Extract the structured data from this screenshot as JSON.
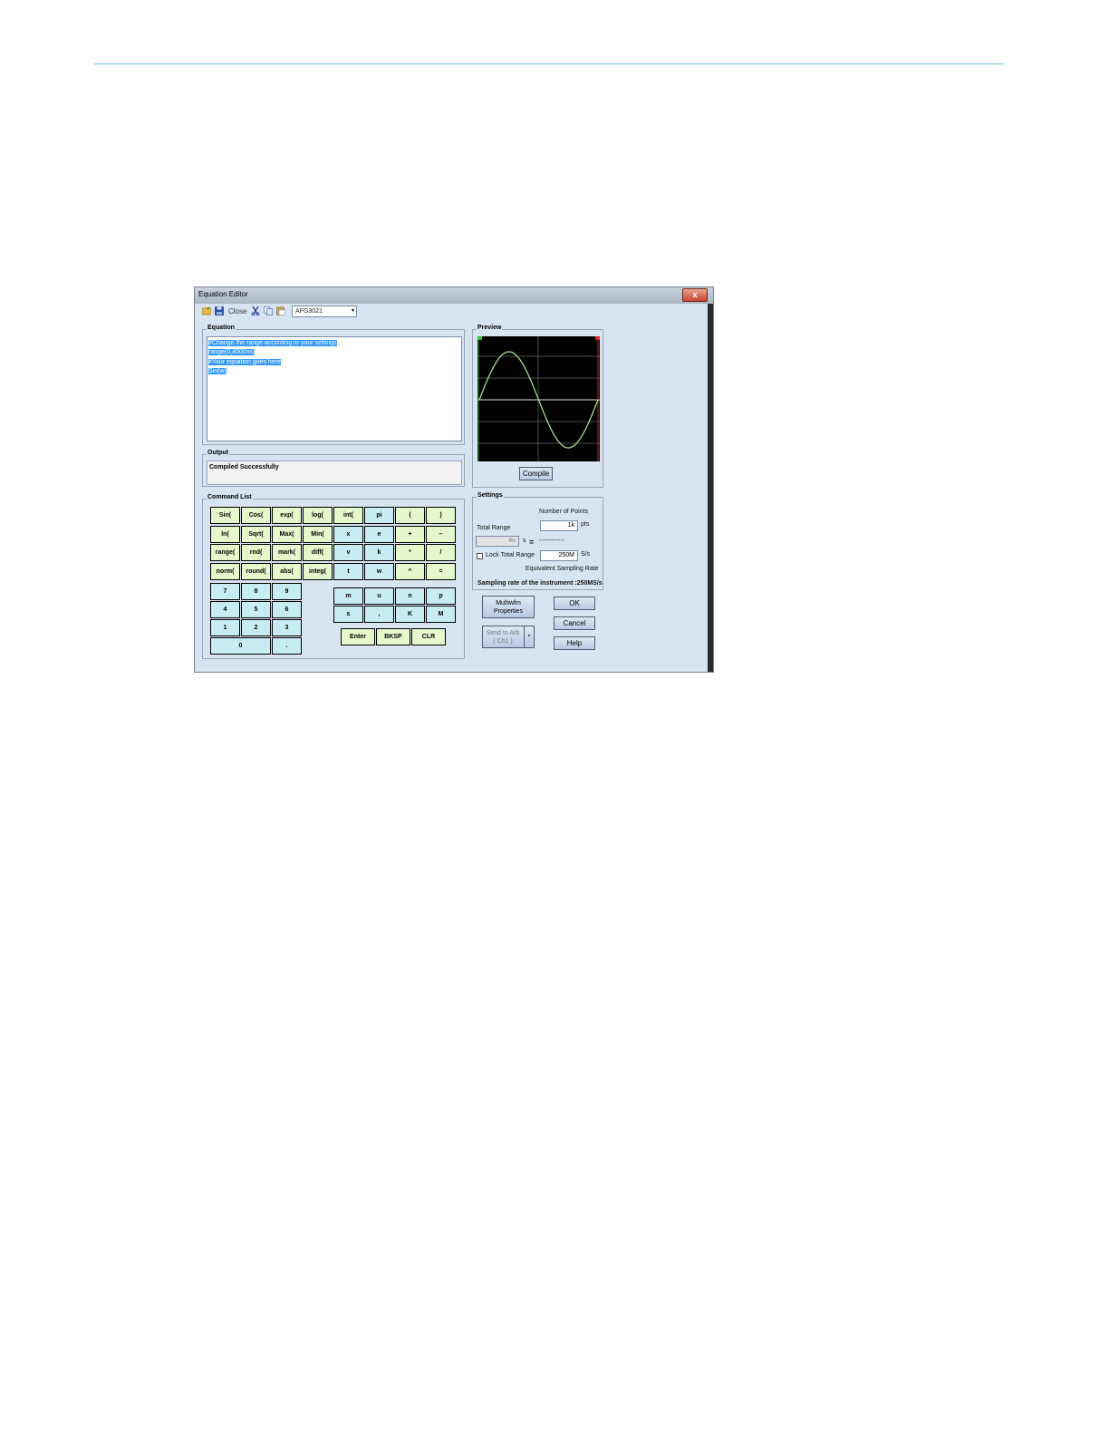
{
  "window": {
    "title": "Equation Editor",
    "close_glyph": "x"
  },
  "toolbar": {
    "close_label": "Close",
    "device": "AFG3021",
    "dropdown_arrow": "▾"
  },
  "equation": {
    "label": "Equation",
    "lines": [
      "#Change the range according to your settings",
      "range(0,4000ns)",
      "#Your equation goes here",
      "Sin(w)"
    ]
  },
  "output": {
    "label": "Output",
    "text": "Compiled Successfully"
  },
  "preview": {
    "label": "Preview",
    "compile_label": "Compile"
  },
  "commands": {
    "label": "Command List",
    "rows": [
      [
        "Sin(",
        "Cos(",
        "exp(",
        "log(",
        "int(",
        "pi",
        "(",
        ")"
      ],
      [
        "ln(",
        "Sqrt(",
        "Max(",
        "Min(",
        "x",
        "e",
        "+",
        "–"
      ],
      [
        "range(",
        "rnd(",
        "mark(",
        "diff(",
        "v",
        "k",
        "*",
        "/"
      ],
      [
        "norm(",
        "round(",
        "abs(",
        "integ(",
        "t",
        "w",
        "^",
        "="
      ]
    ],
    "numpad": [
      [
        "7",
        "8",
        "9"
      ],
      [
        "4",
        "5",
        "6"
      ],
      [
        "1",
        "2",
        "3"
      ]
    ],
    "zero": "0",
    "dot": ".",
    "units": [
      [
        "m",
        "u",
        "n",
        "p"
      ],
      [
        "s",
        ",",
        "K",
        "M"
      ]
    ],
    "enter": "Enter",
    "bksp": "BKSP",
    "clr": "CLR"
  },
  "settings": {
    "label": "Settings",
    "num_points_label": "Number of Points",
    "num_points": "1k",
    "pts_unit": "pts",
    "total_range_label": "Total Range",
    "total_range": "4u",
    "range_unit": "s",
    "equals": "=",
    "dashes": "------------",
    "lock_label": "Lock Total Range",
    "rate": "250M",
    "rate_unit": "S/s",
    "eq_rate_label": "Equivalent Sampling Rate",
    "instr_rate": "Sampling rate of the instrument :250MS/s"
  },
  "buttons": {
    "multiwfm_line1": "Multiwfm",
    "multiwfm_line2": "Properties",
    "send_line1": "Send to Arb",
    "send_line2": "( Ch1 )",
    "ok": "OK",
    "cancel": "Cancel",
    "help": "Help"
  },
  "colors": {
    "trace": "#9fe28a",
    "key_func": "#e7f7cc",
    "key_var": "#c8ecf3",
    "selection": "#3399ff"
  }
}
